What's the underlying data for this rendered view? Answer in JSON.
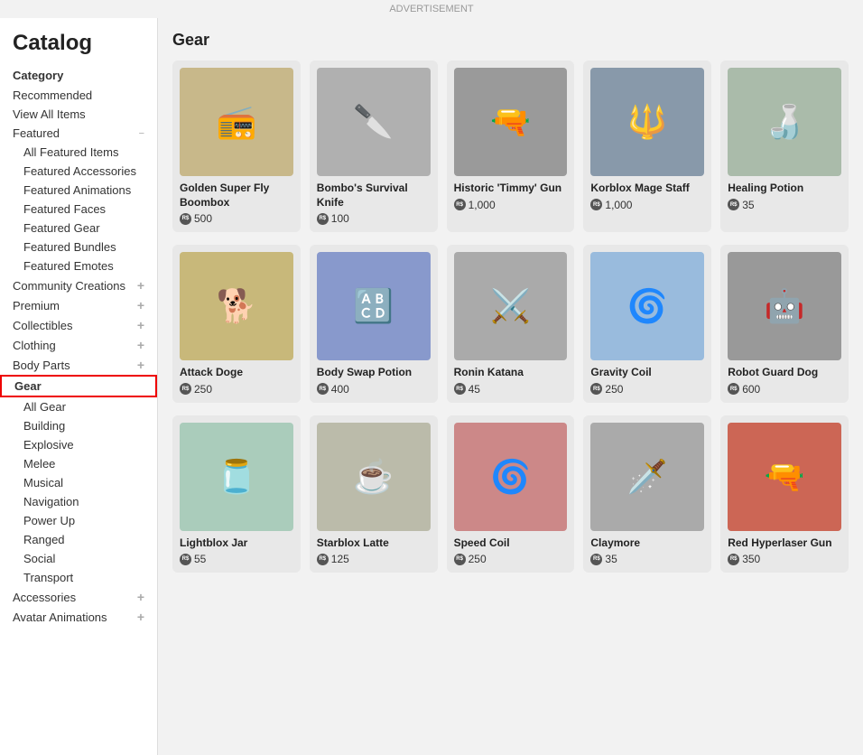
{
  "ad_bar": "ADVERTISEMENT",
  "page_title": "Catalog",
  "sidebar": {
    "category_label": "Category",
    "items": [
      {
        "id": "recommended",
        "label": "Recommended",
        "type": "top",
        "expandable": false
      },
      {
        "id": "view-all",
        "label": "View All Items",
        "type": "top",
        "expandable": false
      },
      {
        "id": "featured",
        "label": "Featured",
        "type": "section",
        "expandable": true,
        "expanded": true,
        "icon": "minus"
      },
      {
        "id": "all-featured",
        "label": "All Featured Items",
        "type": "sub"
      },
      {
        "id": "featured-accessories",
        "label": "Featured Accessories",
        "type": "sub"
      },
      {
        "id": "featured-animations",
        "label": "Featured Animations",
        "type": "sub"
      },
      {
        "id": "featured-faces",
        "label": "Featured Faces",
        "type": "sub"
      },
      {
        "id": "featured-gear",
        "label": "Featured Gear",
        "type": "sub"
      },
      {
        "id": "featured-bundles",
        "label": "Featured Bundles",
        "type": "sub"
      },
      {
        "id": "featured-emotes",
        "label": "Featured Emotes",
        "type": "sub"
      },
      {
        "id": "community-creations",
        "label": "Community Creations",
        "type": "section",
        "expandable": true,
        "icon": "plus"
      },
      {
        "id": "premium",
        "label": "Premium",
        "type": "section",
        "expandable": true,
        "icon": "plus"
      },
      {
        "id": "collectibles",
        "label": "Collectibles",
        "type": "section",
        "expandable": true,
        "icon": "plus"
      },
      {
        "id": "clothing",
        "label": "Clothing",
        "type": "section",
        "expandable": true,
        "icon": "plus"
      },
      {
        "id": "body-parts",
        "label": "Body Parts",
        "type": "section",
        "expandable": true,
        "icon": "plus"
      },
      {
        "id": "gear",
        "label": "Gear",
        "type": "section",
        "expandable": false,
        "active": true
      },
      {
        "id": "all-gear",
        "label": "All Gear",
        "type": "sub"
      },
      {
        "id": "building",
        "label": "Building",
        "type": "sub"
      },
      {
        "id": "explosive",
        "label": "Explosive",
        "type": "sub"
      },
      {
        "id": "melee",
        "label": "Melee",
        "type": "sub"
      },
      {
        "id": "musical",
        "label": "Musical",
        "type": "sub"
      },
      {
        "id": "navigation",
        "label": "Navigation",
        "type": "sub"
      },
      {
        "id": "power-up",
        "label": "Power Up",
        "type": "sub"
      },
      {
        "id": "ranged",
        "label": "Ranged",
        "type": "sub"
      },
      {
        "id": "social",
        "label": "Social",
        "type": "sub"
      },
      {
        "id": "transport",
        "label": "Transport",
        "type": "sub"
      },
      {
        "id": "accessories",
        "label": "Accessories",
        "type": "section",
        "expandable": true,
        "icon": "plus"
      },
      {
        "id": "avatar-animations",
        "label": "Avatar Animations",
        "type": "section",
        "expandable": true,
        "icon": "plus"
      }
    ]
  },
  "content": {
    "section_title": "Gear",
    "rows": [
      {
        "items": [
          {
            "id": 1,
            "name": "Golden Super Fly Boombox",
            "price": 500,
            "emoji": "📻",
            "bg": "#c8b88a"
          },
          {
            "id": 2,
            "name": "Bombo's Survival Knife",
            "price": 100,
            "emoji": "🔪",
            "bg": "#b0b0b0"
          },
          {
            "id": 3,
            "name": "Historic 'Timmy' Gun",
            "price": 1000,
            "emoji": "🔫",
            "bg": "#9a9a9a"
          },
          {
            "id": 4,
            "name": "Korblox Mage Staff",
            "price": 1000,
            "emoji": "🔱",
            "bg": "#8899aa"
          },
          {
            "id": 5,
            "name": "Healing Potion",
            "price": 35,
            "emoji": "🍶",
            "bg": "#aabbaa"
          }
        ]
      },
      {
        "items": [
          {
            "id": 6,
            "name": "Attack Doge",
            "price": 250,
            "emoji": "🐕",
            "bg": "#c8b87a"
          },
          {
            "id": 7,
            "name": "Body Swap Potion",
            "price": 400,
            "emoji": "🔠",
            "bg": "#8899cc"
          },
          {
            "id": 8,
            "name": "Ronin Katana",
            "price": 45,
            "emoji": "⚔️",
            "bg": "#aaaaaa"
          },
          {
            "id": 9,
            "name": "Gravity Coil",
            "price": 250,
            "emoji": "🌀",
            "bg": "#99bbdd"
          },
          {
            "id": 10,
            "name": "Robot Guard Dog",
            "price": 600,
            "emoji": "🤖",
            "bg": "#999999"
          }
        ]
      },
      {
        "items": [
          {
            "id": 11,
            "name": "Lightblox Jar",
            "price": 55,
            "emoji": "🫙",
            "bg": "#aaccbb"
          },
          {
            "id": 12,
            "name": "Starblox Latte",
            "price": 125,
            "emoji": "☕",
            "bg": "#bbbbaa"
          },
          {
            "id": 13,
            "name": "Speed Coil",
            "price": 250,
            "emoji": "🌀",
            "bg": "#cc8888"
          },
          {
            "id": 14,
            "name": "Claymore",
            "price": 35,
            "emoji": "🗡️",
            "bg": "#aaaaaa"
          },
          {
            "id": 15,
            "name": "Red Hyperlaser Gun",
            "price": "350",
            "emoji": "🔫",
            "bg": "#cc6655"
          }
        ]
      }
    ]
  }
}
